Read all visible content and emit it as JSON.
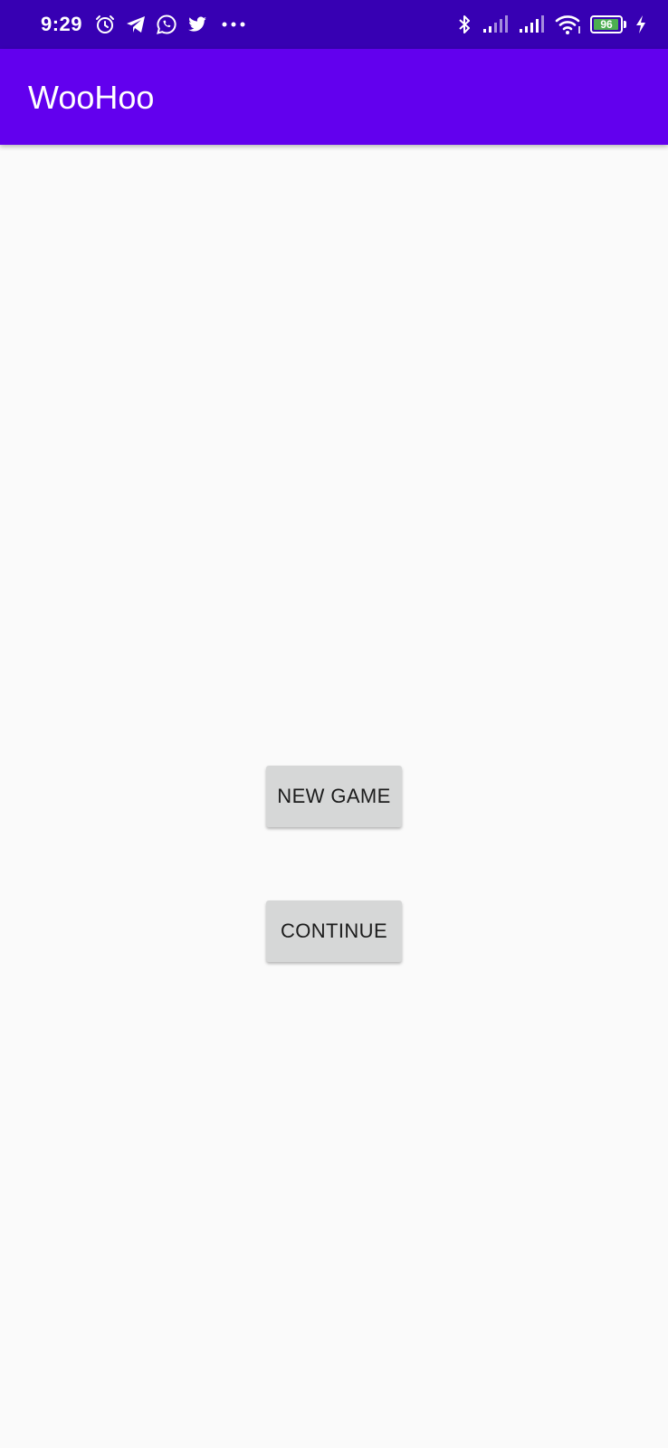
{
  "status_bar": {
    "time": "9:29",
    "battery_level": "96",
    "battery_fraction": 0.96,
    "left_icons": [
      "alarm-icon",
      "telegram-icon",
      "whatsapp-icon",
      "twitter-icon",
      "more-notifications-icon"
    ],
    "right_icons": [
      "bluetooth-icon",
      "signal-1-icon",
      "signal-2-icon",
      "wifi-icon",
      "battery-icon",
      "charging-icon"
    ]
  },
  "app_bar": {
    "title": "WooHoo"
  },
  "main": {
    "new_game_label": "NEW GAME",
    "continue_label": "CONTINUE"
  },
  "colors": {
    "status_bar": "#3700b3",
    "app_bar": "#6200ee",
    "background": "#fafafa",
    "button": "#d6d7d7",
    "battery_fill": "#4caf50"
  }
}
